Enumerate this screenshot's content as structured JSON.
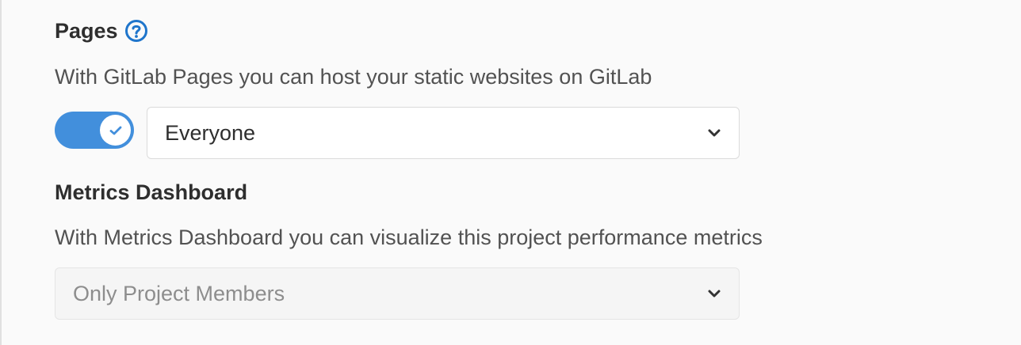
{
  "pages": {
    "title": "Pages",
    "help_icon": "question-circle-icon",
    "description": "With GitLab Pages you can host your static websites on GitLab",
    "toggle_enabled": true,
    "access_level": "Everyone"
  },
  "metrics": {
    "title": "Metrics Dashboard",
    "description": "With Metrics Dashboard you can visualize this project performance metrics",
    "access_level": "Only Project Members",
    "disabled": true
  },
  "colors": {
    "accent": "#428fdc",
    "title_text": "#2e2e2e",
    "body_text": "#525252",
    "disabled_text": "#8d8d8d"
  }
}
